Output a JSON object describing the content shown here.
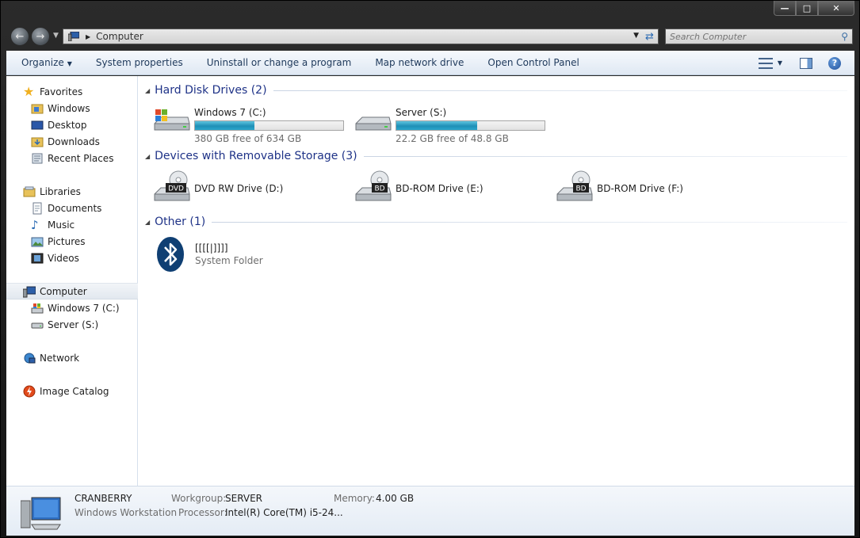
{
  "address": {
    "path": "Computer"
  },
  "search": {
    "placeholder": "Search Computer"
  },
  "toolbar": {
    "organize": "Organize",
    "system_properties": "System properties",
    "uninstall": "Uninstall or change a program",
    "map_drive": "Map network drive",
    "control_panel": "Open Control Panel"
  },
  "nav": {
    "favorites": "Favorites",
    "windows": "Windows",
    "desktop": "Desktop",
    "downloads": "Downloads",
    "recent": "Recent Places",
    "libraries": "Libraries",
    "documents": "Documents",
    "music": "Music",
    "pictures": "Pictures",
    "videos": "Videos",
    "computer": "Computer",
    "drive_c": "Windows 7 (C:)",
    "drive_s": "Server (S:)",
    "network": "Network",
    "image_catalog": "Image Catalog"
  },
  "groups": {
    "hard_disks": "Hard Disk Drives (2)",
    "removable": "Devices with Removable Storage (3)",
    "other": "Other (1)"
  },
  "drives": [
    {
      "name": "Windows 7 (C:)",
      "free": "380 GB free of 634 GB",
      "used_fraction": 0.4
    },
    {
      "name": "Server (S:)",
      "free": "22.2 GB free of 48.8 GB",
      "used_fraction": 0.545
    }
  ],
  "devices": [
    {
      "name": "DVD RW Drive (D:)",
      "badge": "DVD"
    },
    {
      "name": "BD-ROM Drive (E:)",
      "badge": "BD"
    },
    {
      "name": "BD-ROM Drive (F:)",
      "badge": "BD"
    }
  ],
  "other_item": {
    "name": "[[[[|]]]]",
    "type": "System Folder"
  },
  "details": {
    "computer_name": "CRANBERRY",
    "description": "Windows Workstation",
    "workgroup_label": "Workgroup:",
    "workgroup": "SERVER",
    "memory_label": "Memory:",
    "memory": "4.00 GB",
    "processor_label": "Processor:",
    "processor": "Intel(R) Core(TM) i5-24..."
  },
  "colors": {
    "accent": "#1e3287",
    "bar": "#2ba7cc"
  }
}
